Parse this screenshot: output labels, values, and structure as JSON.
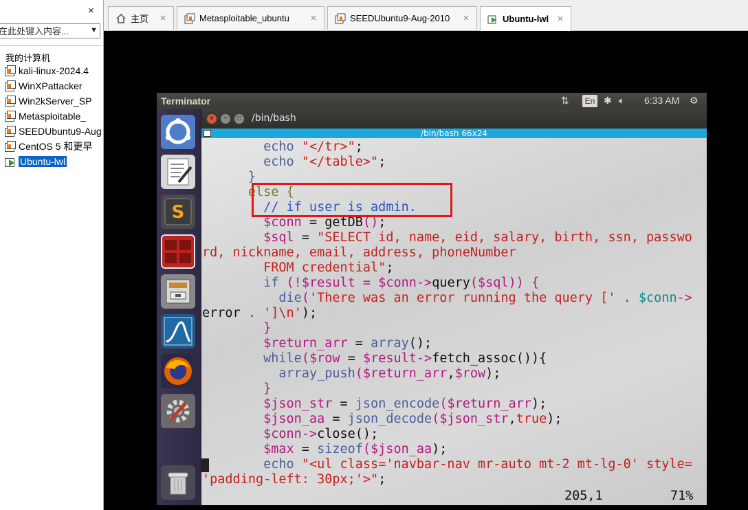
{
  "library": {
    "close_glyph": "×",
    "search_placeholder": "在此处键入内容...",
    "root_label": "我的计算机",
    "vms": [
      {
        "label": "kali-linux-2024.4"
      },
      {
        "label": "WinXPattacker"
      },
      {
        "label": "Win2kServer_SP"
      },
      {
        "label": "Metasploitable_"
      },
      {
        "label": "SEEDUbuntu9-Aug"
      },
      {
        "label": "CentOS 5 和更早"
      },
      {
        "label": "Ubuntu-lwl",
        "selected": true,
        "running": true
      }
    ]
  },
  "tabs": [
    {
      "label": "主页",
      "icon": "home-icon"
    },
    {
      "label": "Metasploitable_ubuntu",
      "icon": "vm-icon"
    },
    {
      "label": "SEEDUbuntu9-Aug-2010",
      "icon": "vm-icon"
    },
    {
      "label": "Ubuntu-lwl",
      "icon": "vm-running-icon",
      "active": true
    }
  ],
  "guest": {
    "topbar": {
      "app_title": "Terminator",
      "keyboard_layout": "En",
      "time": "6:33 AM",
      "icons": [
        "network-icon",
        "bluetooth-icon",
        "volume-icon",
        "power-icon"
      ]
    },
    "launcher": [
      "ubuntu-dash-icon",
      "text-editor-icon",
      "sublime-text-icon",
      "terminator-icon",
      "file-manager-icon",
      "wireshark-icon",
      "firefox-icon",
      "system-settings-icon",
      "trash-icon"
    ],
    "terminal": {
      "window_title": "/bin/bash",
      "bar_title": "/bin/bash 66x24",
      "lines": [
        [
          [
            "        ",
            ""
          ],
          [
            "echo ",
            "kw"
          ],
          [
            "\"</tr>\"",
            "str"
          ],
          [
            ";",
            ""
          ]
        ],
        [
          [
            "        ",
            ""
          ],
          [
            "echo ",
            "kw"
          ],
          [
            "\"</table>\"",
            "str"
          ],
          [
            ";",
            ""
          ]
        ],
        [
          [
            "      ",
            ""
          ],
          [
            "}",
            "kw"
          ]
        ],
        [
          [
            "      ",
            ""
          ],
          [
            "else {",
            "olive"
          ]
        ],
        [
          [
            "        ",
            ""
          ],
          [
            "// if user is admin.",
            "com"
          ]
        ],
        [
          [
            "        ",
            ""
          ],
          [
            "$conn",
            "var"
          ],
          [
            " = ",
            ""
          ],
          [
            "getDB",
            ""
          ],
          [
            "()",
            "var"
          ],
          [
            ";",
            ""
          ]
        ],
        [
          [
            "        ",
            ""
          ],
          [
            "$sql",
            "var"
          ],
          [
            " = ",
            ""
          ],
          [
            "\"SELECT id, name, eid, salary, birth, ssn, passwo",
            "str"
          ]
        ],
        [
          [
            "rd, nickname, email, address, phoneNumber",
            "str"
          ]
        ],
        [
          [
            "        ",
            ""
          ],
          [
            "FROM credential\"",
            "str"
          ],
          [
            ";",
            ""
          ]
        ],
        [
          [
            "        ",
            ""
          ],
          [
            "if ",
            "kw"
          ],
          [
            "(!",
            "var"
          ],
          [
            "$result",
            "var"
          ],
          [
            " = ",
            "var"
          ],
          [
            "$conn",
            "var"
          ],
          [
            "->",
            "var"
          ],
          [
            "query",
            ""
          ],
          [
            "(",
            "var"
          ],
          [
            "$sql",
            "var"
          ],
          [
            ")) {",
            "var"
          ]
        ],
        [
          [
            "          ",
            ""
          ],
          [
            "die",
            "kw"
          ],
          [
            "(",
            "var"
          ],
          [
            "'There was an error running the query [' ",
            "str"
          ],
          [
            ". ",
            "var"
          ],
          [
            "$conn",
            "teal"
          ],
          [
            "->",
            "var"
          ]
        ],
        [
          [
            "error",
            ""
          ],
          [
            " . ",
            "var"
          ],
          [
            "']\\n'",
            "str"
          ],
          [
            ");",
            ""
          ]
        ],
        [
          [
            "        ",
            ""
          ],
          [
            "}",
            "var"
          ]
        ],
        [
          [
            "        ",
            ""
          ],
          [
            "$return_arr",
            "var"
          ],
          [
            " = ",
            ""
          ],
          [
            "array",
            "kw"
          ],
          [
            "();",
            ""
          ]
        ],
        [
          [
            "        ",
            ""
          ],
          [
            "while",
            "kw"
          ],
          [
            "(",
            "var"
          ],
          [
            "$row",
            "var"
          ],
          [
            " = ",
            ""
          ],
          [
            "$result",
            "var"
          ],
          [
            "->",
            "var"
          ],
          [
            "fetch_assoc",
            ""
          ],
          [
            "()){",
            ""
          ]
        ],
        [
          [
            "          ",
            ""
          ],
          [
            "array_push",
            "kw"
          ],
          [
            "(",
            "var"
          ],
          [
            "$return_arr",
            "var"
          ],
          [
            ",",
            ""
          ],
          [
            "$row",
            "var"
          ],
          [
            ");",
            ""
          ]
        ],
        [
          [
            "        ",
            ""
          ],
          [
            "}",
            "var"
          ]
        ],
        [
          [
            "        ",
            ""
          ],
          [
            "$json_str",
            "var"
          ],
          [
            " = ",
            ""
          ],
          [
            "json_encode",
            "kw"
          ],
          [
            "(",
            "var"
          ],
          [
            "$return_arr",
            "var"
          ],
          [
            ");",
            ""
          ]
        ],
        [
          [
            "        ",
            ""
          ],
          [
            "$json_aa",
            "var"
          ],
          [
            " = ",
            ""
          ],
          [
            "json_decode",
            "kw"
          ],
          [
            "(",
            "var"
          ],
          [
            "$json_str",
            "var"
          ],
          [
            ",",
            ""
          ],
          [
            "true",
            "str"
          ],
          [
            ");",
            ""
          ]
        ],
        [
          [
            "        ",
            ""
          ],
          [
            "$conn",
            "var"
          ],
          [
            "->",
            "var"
          ],
          [
            "close",
            ""
          ],
          [
            "();",
            ""
          ]
        ],
        [
          [
            "        ",
            ""
          ],
          [
            "$max",
            "var"
          ],
          [
            " = ",
            ""
          ],
          [
            "sizeof",
            "kw"
          ],
          [
            "(",
            "var"
          ],
          [
            "$json_aa",
            "var"
          ],
          [
            ");",
            ""
          ]
        ],
        [
          [
            "        ",
            ""
          ],
          [
            "echo ",
            "kw"
          ],
          [
            "\"<ul class='navbar-nav mr-auto mt-2 mt-lg-0' style=",
            "str"
          ]
        ],
        [
          [
            "'padding-left: 30px;'>\"",
            "str"
          ],
          [
            ";",
            ""
          ]
        ]
      ],
      "cursor_position": "205,1",
      "scroll_percent": "71%"
    }
  },
  "colors": {
    "kw": "#4a5f9a",
    "str": "#c4201e",
    "var": "#b0197e",
    "com": "#2f56c0",
    "olive": "#7a7a28",
    "teal": "#0b8a8a",
    "terminal_bar": "#1ea7dd",
    "annotation_box": "#e0181c"
  }
}
